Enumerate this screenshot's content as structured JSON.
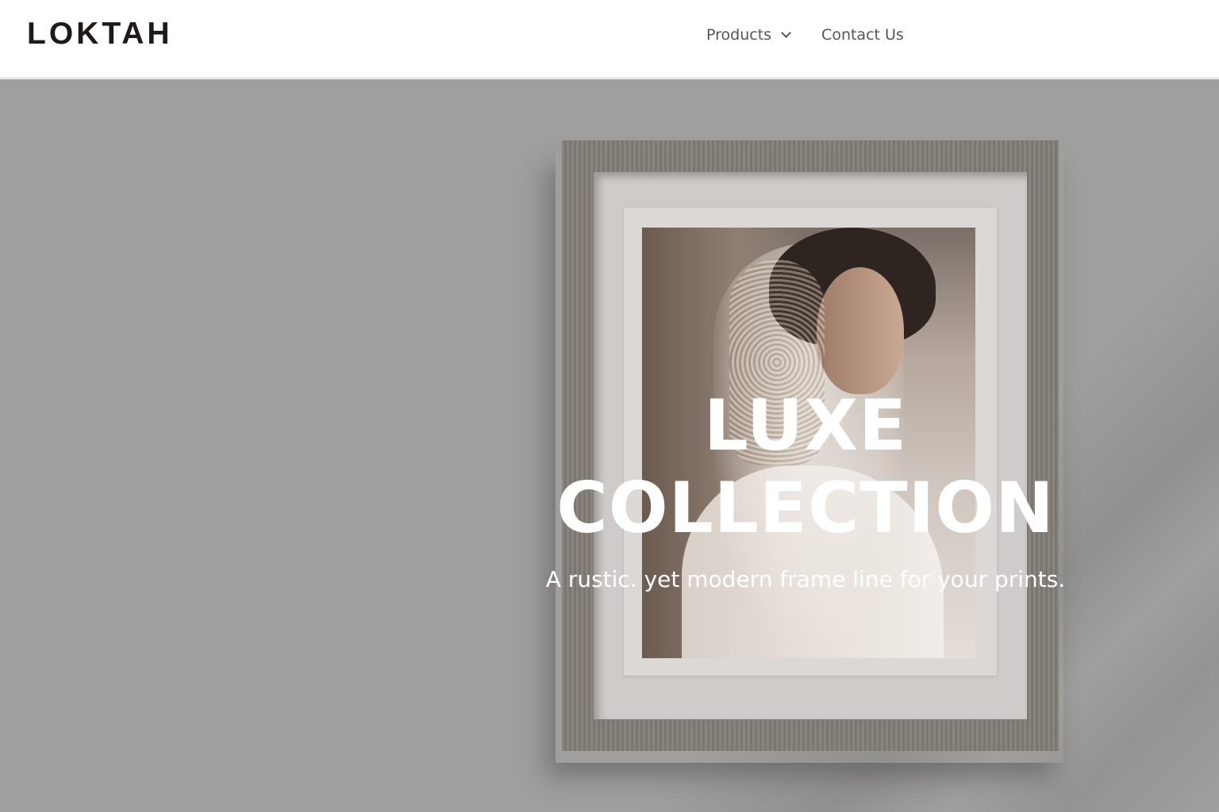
{
  "header": {
    "logo": "LOKTAH",
    "nav": {
      "products_label": "Products",
      "products_icon": "chevron-down-icon",
      "contact_label": "Contact Us"
    }
  },
  "hero": {
    "title": "LUXE COLLECTION",
    "subtitle": "A rustic. yet modern frame line for your prints.",
    "background_color": "#a09f9e",
    "frame_color": "#847d78",
    "image_description_icon": "framed-photo"
  }
}
